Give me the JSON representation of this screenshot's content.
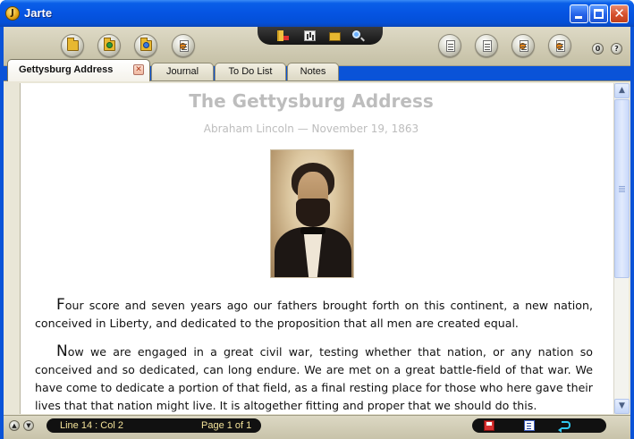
{
  "window": {
    "title": "Jarte",
    "app_icon_letter": "J"
  },
  "toolbar": {
    "help_label": "?",
    "counter_label": "0"
  },
  "tabs": [
    {
      "label": "Gettysburg Address",
      "active": true
    },
    {
      "label": "Journal",
      "active": false
    },
    {
      "label": "To Do List",
      "active": false
    },
    {
      "label": "Notes",
      "active": false
    }
  ],
  "document": {
    "title": "The Gettysburg Address",
    "subtitle": "Abraham Lincoln — November 19, 1863",
    "paragraph1_dropcap": "F",
    "paragraph1_rest": "our score and seven years ago our fathers brought forth on this continent, a new nation, conceived in Liberty, and dedicated to the proposition that all men are created equal.",
    "paragraph2_dropcap": "N",
    "paragraph2_rest": "ow we are engaged in a great civil war, testing whether that nation, or any nation so conceived and so dedicated, can long endure. We are met on a great battle-field of that war. We have come to dedicate a portion of that field, as a final resting place for those who here gave their lives that that nation might live. It is altogether fitting and proper that we should do this."
  },
  "status": {
    "line_col": "Line 14 : Col 2",
    "page": "Page 1 of 1"
  },
  "colors": {
    "titlebar": "#0554e2",
    "toolbar": "#cfcab2",
    "status_text": "#f4e39a"
  }
}
